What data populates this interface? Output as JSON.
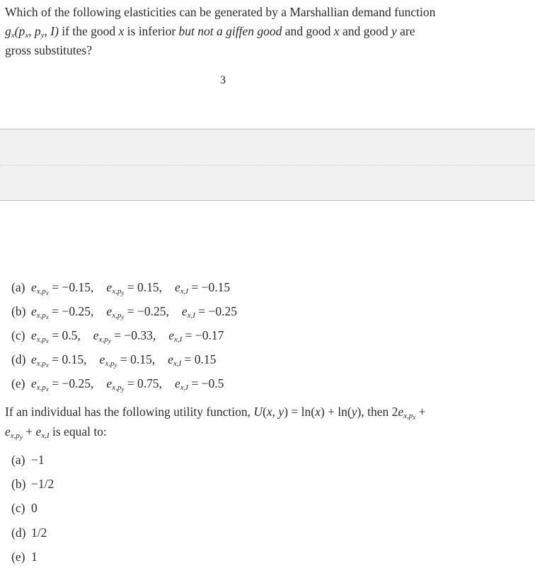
{
  "question1": {
    "line1": "Which of the following elasticities can be generated by a Marshallian demand function",
    "line2_func": "g",
    "line2_func_sub": "x",
    "line2_args": "(p_x, p_y, I)",
    "line2_text_a": " if the good ",
    "line2_var_x": "x",
    "line2_text_b": " is inferior ",
    "line2_italic": "but not a giffen good",
    "line2_text_c": " and good ",
    "line2_var_x2": "x",
    "line2_text_d": " and good ",
    "line2_var_y": "y",
    "line2_text_e": " are",
    "line3": "gross substitutes?",
    "options": [
      {
        "label": "(a)",
        "e_px": "= −0.15,",
        "e_py": "= 0.15,",
        "e_I": "= −0.15"
      },
      {
        "label": "(b)",
        "e_px": "= −0.25,",
        "e_py": "= −0.25,",
        "e_I": "= −0.25"
      },
      {
        "label": "(c)",
        "e_px": "= 0.5,",
        "e_py": "= −0.33,",
        "e_I": "= −0.17"
      },
      {
        "label": "(d)",
        "e_px": "= 0.15,",
        "e_py": "= 0.15,",
        "e_I": "= 0.15"
      },
      {
        "label": "(e)",
        "e_px": "= −0.25,",
        "e_py": "= 0.75,",
        "e_I": "= −0.5"
      }
    ]
  },
  "page_number": "3",
  "question2": {
    "line1_text": "If an individual has the following utility function, ",
    "utility": "U(x, y) = ln(x) + ln(y)",
    "line1_then": ", then 2",
    "line1_plus": " +",
    "line2_plus": " + ",
    "line2_tail": " is equal to:",
    "options": [
      {
        "label": "(a)",
        "value": "−1"
      },
      {
        "label": "(b)",
        "value": "−1/2"
      },
      {
        "label": "(c)",
        "value": "0"
      },
      {
        "label": "(d)",
        "value": "1/2"
      },
      {
        "label": "(e)",
        "value": "1"
      }
    ]
  },
  "symbols": {
    "e": "e",
    "sub_x": "x",
    "sub_px_p": "p",
    "sub_px_x": "x",
    "sub_py_y": "y",
    "sub_I": "I",
    "comma": ","
  }
}
